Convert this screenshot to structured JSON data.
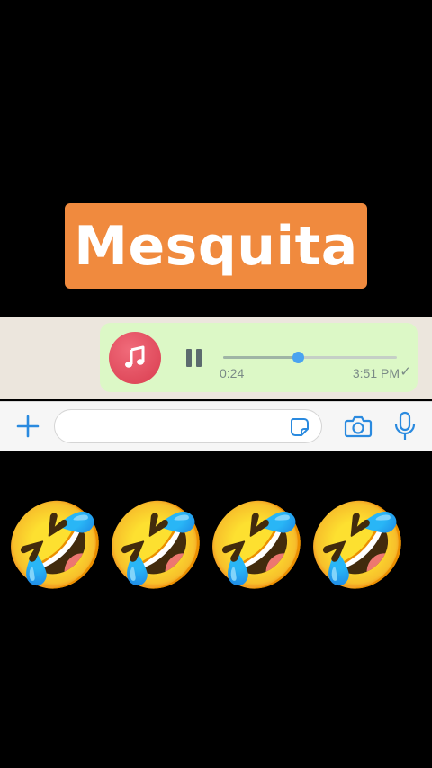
{
  "title_label": "Mesquita",
  "colors": {
    "title_bg": "#f08a3e",
    "bubble_bg": "#dcf8c6",
    "accent_blue": "#4aa3f0",
    "avatar_red": "#d93c4f"
  },
  "voice_message": {
    "avatar_icon": "music-note-icon",
    "control_icon": "pause-icon",
    "elapsed": "0:24",
    "timestamp": "3:51 PM",
    "status_icon": "single-check-icon",
    "progress": 0.43
  },
  "input_bar": {
    "plus_icon": "plus-icon",
    "sticker_icon": "sticker-icon",
    "camera_icon": "camera-icon",
    "mic_icon": "microphone-icon",
    "placeholder": ""
  },
  "reactions": [
    "🤣",
    "🤣",
    "🤣",
    "🤣"
  ]
}
